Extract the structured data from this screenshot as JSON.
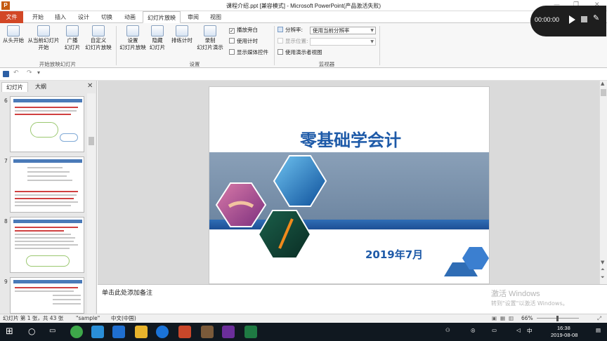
{
  "window": {
    "title": "课程介绍.ppt [兼容模式] - Microsoft PowerPoint(产品激活失败)",
    "app_icon": "P"
  },
  "tabs": [
    "文件",
    "开始",
    "插入",
    "设计",
    "切换",
    "动画",
    "幻灯片放映",
    "审阅",
    "视图"
  ],
  "active_tab": "幻灯片放映",
  "ribbon": {
    "group_start": {
      "from_beginning": "从头开始",
      "from_current_l1": "从当前幻灯片",
      "from_current_l2": "开始",
      "broadcast_l1": "广播",
      "broadcast_l2": "幻灯片",
      "custom_l1": "自定义",
      "custom_l2": "幻灯片放映",
      "label": "开始放映幻灯片"
    },
    "group_setup": {
      "setup_l1": "设置",
      "setup_l2": "幻灯片放映",
      "hide_l1": "隐藏",
      "hide_l2": "幻灯片",
      "rehearse": "排练计时",
      "record_l1": "录制",
      "record_l2": "幻灯片演示",
      "play_narrations": "播放旁白",
      "use_timings": "使用计时",
      "show_media_controls": "显示媒体控件",
      "label": "设置"
    },
    "group_monitors": {
      "resolution_label": "分辨率:",
      "resolution_value": "使用当前分辨率",
      "show_on_label": "显示位置:",
      "presenter_view": "使用演示者视图",
      "label": "监视器"
    },
    "accent": "#d24726"
  },
  "recorder": {
    "time": "00:00:00"
  },
  "slide_panel": {
    "tab_slides": "幻灯片",
    "tab_outline": "大纲",
    "thumb_numbers": [
      "6",
      "7",
      "8",
      "9"
    ]
  },
  "slide": {
    "title": "零基础学会计",
    "date": "2019年7月"
  },
  "notes": {
    "placeholder": "单击此处添加备注"
  },
  "watermark": {
    "line1": "激活 Windows",
    "line2": "转到\"设置\"以激活 Windows。"
  },
  "status": {
    "slide_info": "幻灯片 第 1 张，共 43 张",
    "theme": "\"sample\"",
    "language": "中文(中国)",
    "zoom": "66%"
  },
  "taskbar": {
    "time": "16:38",
    "date": "2019-08-08",
    "ime": "中"
  }
}
